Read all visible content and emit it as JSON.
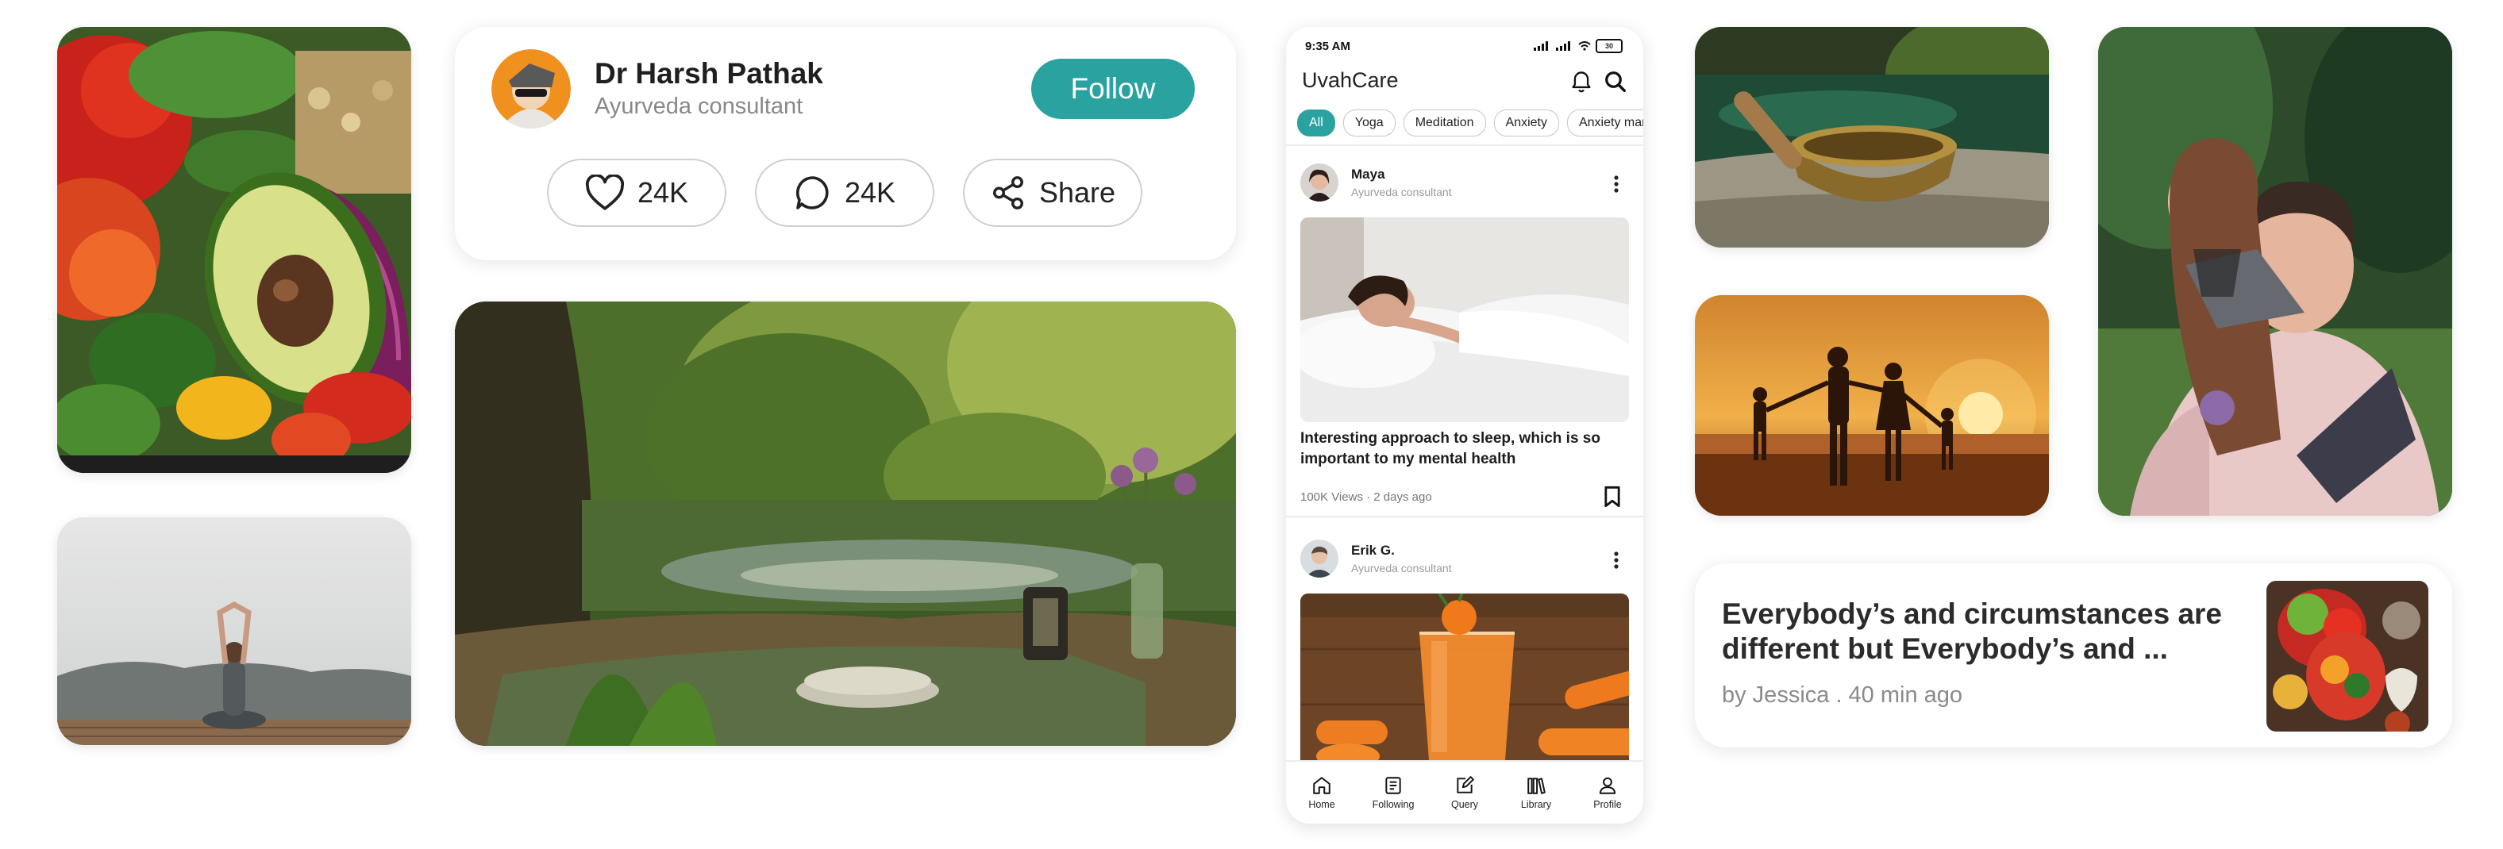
{
  "profile": {
    "name": "Dr Harsh Pathak",
    "role": "Ayurveda consultant",
    "follow_label": "Follow",
    "likes": "24K",
    "comments": "24K",
    "share_label": "Share"
  },
  "phone": {
    "status_time": "9:35 AM",
    "battery": "30",
    "app_title": "UvahCare",
    "chips": [
      "All",
      "Yoga",
      "Meditation",
      "Anxiety",
      "Anxiety man"
    ],
    "posts": [
      {
        "author": "Maya",
        "role": "Ayurveda consultant",
        "text": "Interesting approach to sleep, which is so important to my mental health",
        "meta": "100K Views · 2 days ago"
      },
      {
        "author": "Erik G.",
        "role": "Ayurveda consultant"
      }
    ],
    "nav": [
      "Home",
      "Following",
      "Query",
      "Library",
      "Profile"
    ]
  },
  "article": {
    "title": "Everybody’s  and circumstances are different but Everybody’s  and ...",
    "meta": "by Jessica . 40 min ago"
  },
  "colors": {
    "accent": "#2aa3a0"
  },
  "icons": [
    "heart-icon",
    "comment-icon",
    "share-icon",
    "bell-icon",
    "search-icon",
    "more-icon",
    "bookmark-icon",
    "home-icon",
    "following-icon",
    "query-icon",
    "library-icon",
    "profile-icon"
  ]
}
